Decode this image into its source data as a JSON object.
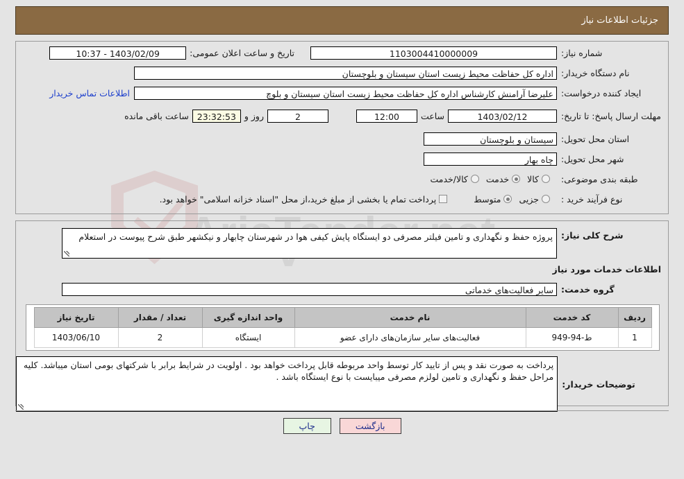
{
  "header": {
    "title": "جزئیات اطلاعات نیاز"
  },
  "need_info": {
    "need_number_label": "شماره نیاز:",
    "need_number_value": "1103004410000009",
    "announce_datetime_label": "تاریخ و ساعت اعلان عمومی:",
    "announce_datetime_value": "10:37 - 1403/02/09",
    "buyer_org_label": "نام دستگاه خریدار:",
    "buyer_org_value": "اداره کل حفاظت محیط زیست استان سیستان و بلوچستان",
    "requester_label": "ایجاد کننده درخواست:",
    "requester_value": "علیرضا آرامنش کارشناس اداره کل حفاظت محیط زیست استان سیستان و بلوچ",
    "contact_link": "اطلاعات تماس خریدار",
    "deadline_label": "مهلت ارسال پاسخ: تا تاریخ:",
    "deadline_date": "1403/02/12",
    "deadline_time_label": "ساعت",
    "deadline_time": "12:00",
    "days_remaining": "2",
    "days_unit_label": "روز و",
    "hours_remaining": "23:32:53",
    "hours_unit_label": "ساعت باقی مانده",
    "province_label": "استان محل تحویل:",
    "province_value": "سیستان و بلوچستان",
    "city_label": "شهر محل تحویل:",
    "city_value": "چاه بهار",
    "category_label": "طبقه بندی موضوعی:",
    "category_options": [
      {
        "label": "کالا",
        "selected": false
      },
      {
        "label": "خدمت",
        "selected": true
      },
      {
        "label": "کالا/خدمت",
        "selected": false
      }
    ],
    "process_type_label": "نوع فرآیند خرید :",
    "process_type_options": [
      {
        "label": "جزیی",
        "selected": false
      },
      {
        "label": "متوسط",
        "selected": true
      }
    ],
    "treasury_checkbox_label": "پرداخت تمام یا بخشی از مبلغ خرید،از محل \"اسناد خزانه اسلامی\" خواهد بود.",
    "treasury_checked": false
  },
  "general_desc": {
    "label": "شرح کلی نیاز:",
    "value": "پروژه حفظ و نگهداری و تامین فیلتر مصرفی دو ایستگاه پایش کیفی هوا در شهرستان چابهار و نیکشهر طبق شرح پیوست در استعلام"
  },
  "services_section": {
    "heading": "اطلاعات خدمات مورد نیاز",
    "group_label": "گروه خدمت:",
    "group_value": "سایر فعالیت‌های خدماتی"
  },
  "table": {
    "columns": [
      "ردیف",
      "کد خدمت",
      "نام خدمت",
      "واحد اندازه گیری",
      "تعداد / مقدار",
      "تاریخ نیاز"
    ],
    "rows": [
      {
        "row_no": "1",
        "service_code": "ط-94-949",
        "service_name": "فعالیت‌های سایر سازمان‌های دارای عضو",
        "unit": "ایستگاه",
        "quantity": "2",
        "need_date": "1403/06/10"
      }
    ]
  },
  "buyer_notes": {
    "label": "توضیحات خریدار:",
    "value": "پرداخت به صورت نقد و پس از تایید کار توسط واحد مربوطه قابل پرداخت خواهد بود . اولویت در شرایط برابر با شرکتهای بومی استان میباشد. کلیه مراحل حفظ و نگهداری و تامین لولزم مصرفی میبایست با نوع ایستگاه باشد ."
  },
  "footer": {
    "print_label": "چاپ",
    "back_label": "بازگشت"
  },
  "watermark": {
    "text": "AriaTender.net",
    "letter": "V"
  },
  "colors": {
    "header_bg": "#8a6a43",
    "page_bg": "#e4e4e4",
    "link": "#1d3fcc",
    "table_header_bg": "#c4c4c4",
    "print_btn_bg": "#e7f5e3",
    "back_btn_bg": "#f9d7d7",
    "countdown_bg": "#fbfbe4"
  }
}
